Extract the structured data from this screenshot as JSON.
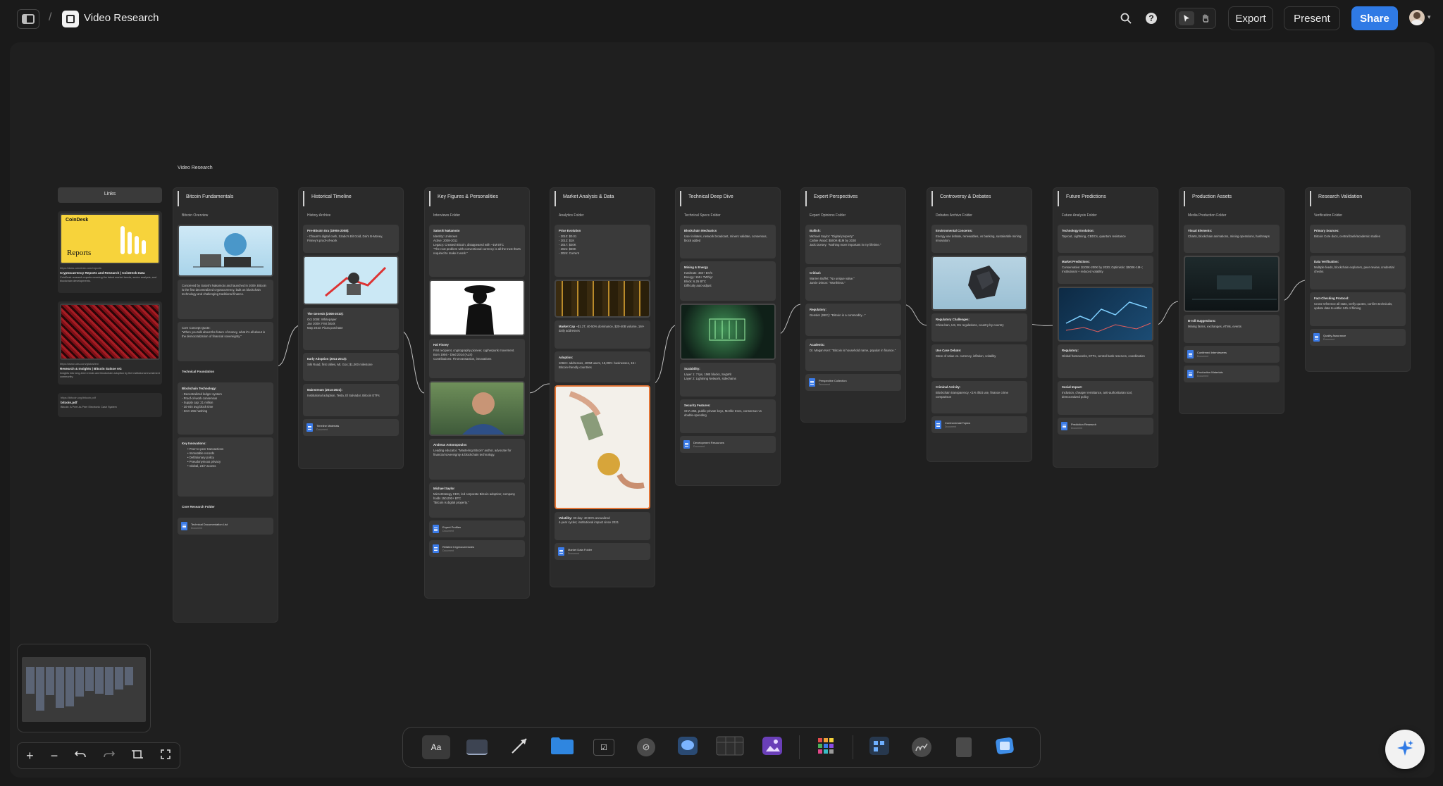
{
  "app": {
    "breadcrumb_sep": "/",
    "title": "Video Research"
  },
  "header": {
    "export": "Export",
    "present": "Present",
    "share": "Share"
  },
  "board": {
    "label": "Video Research"
  },
  "links": {
    "title": "Links",
    "items": [
      {
        "thumb_brand": "CoinDesk",
        "thumb_title": "Reports",
        "url": "https://data.coindesk.com/reports",
        "title": "Cryptocurrency Reports and Research | CoinDesk Data",
        "desc": "CoinDesk research reports covering the latest market trends, sector analysis, and blockchain developments."
      },
      {
        "url": "https://www.ubs.com/global/en/",
        "title": "Research & Insights | Bitcoin Suisse AG",
        "desc": "Insights into long-term trends and blockchain adoption by the institutional investment community."
      },
      {
        "url": "https://bitcoin.org/bitcoin.pdf",
        "title": "bitcoin.pdf",
        "desc": "Bitcoin: A Peer-to-Peer Electronic Cash System"
      }
    ]
  },
  "columns": [
    {
      "title": "Bitcoin Fundamentals",
      "sub": "Bitcoin Overview"
    },
    {
      "title": "Historical Timeline",
      "sub": "History Archive"
    },
    {
      "title": "Key Figures & Personalities",
      "sub": "Interviews Folder"
    },
    {
      "title": "Market Analysis & Data",
      "sub": "Analytics Folder"
    },
    {
      "title": "Technical Deep Dive",
      "sub": "Technical Specs Folder"
    },
    {
      "title": "Expert Perspectives",
      "sub": "Expert Opinions Folder"
    },
    {
      "title": "Controversy & Debates",
      "sub": "Debates Archive Folder"
    },
    {
      "title": "Future Predictions",
      "sub": "Future Analysis Folder"
    },
    {
      "title": "Production Assets",
      "sub": "Media Production Folder"
    },
    {
      "title": "Research Validation",
      "sub": "Verification Folder"
    }
  ],
  "fundamentals": {
    "intro": "Conceived by Satoshi Nakamoto and launched in 2009, Bitcoin is the first decentralized cryptocurrency, built on blockchain technology and challenging traditional finance.",
    "quote_title": "Core Concept Quote:",
    "quote": "\"When you talk about the future of money, what it's all about is the democratization of financial sovereignty.\"",
    "tech_foundation": "Technical Foundation",
    "bt_title": "Blockchain Technology:",
    "bt_items": [
      "- Decentralized ledger system",
      "- Proof-of-work consensus",
      "- Supply cap: 21 million",
      "- 10-min avg block time",
      "- SHA-256 hashing"
    ],
    "ki_title": "Key Innovations:",
    "ki_items": [
      "• Peer-to-peer transactions",
      "• Immutable records",
      "• Deflationary policy",
      "• Pseudonymous privacy",
      "• Global, 24/7 access"
    ],
    "core_folder": "Core Research Folder",
    "doc": "Technical Documentation List"
  },
  "history": {
    "c1_title": "Pre-Bitcoin Era (1990s-2008):",
    "c1": "- Chaum's digital cash, Szabo's Bit Gold, Dai's B-Money, Finney's proof-of-work",
    "c2_title": "The Genesis (2008-2010):",
    "c2": "Oct 2008: Whitepaper\nJan 2009: First block\nMay 2010: Pizza purchase",
    "c3_title": "Early Adoption (2011-2013):",
    "c3": "Silk Road, first rallies, Mt. Gox; $1,000 milestone",
    "c4_title": "Mainstream (2014-2021):",
    "c4": "Institutional adoption, Tesla, El Salvador, Bitcoin ETFs",
    "doc": "Timeline Materials"
  },
  "figures": {
    "c1_title": "Satoshi Nakamoto",
    "c1": "Identity: Unknown\nActive: 2008-2011\nLegacy: Created Bitcoin, disappeared with ~1M BTC\n\"The root problem with conventional currency is all the trust that's required to make it work.\"",
    "c2_title": "Hal Finney",
    "c2": "First recipient, cryptography pioneer, cypherpunk movement.\nBorn 1956 - Died 2014 (ALS)\nContributions: First transaction, innovations",
    "c3_title": "Andreas Antonopoulos",
    "c3": "Leading educator, \"Mastering Bitcoin\" author, advocate for financial sovereignty & blockchain technology.",
    "c4_title": "Michael Saylor",
    "c4": "MicroStrategy CEO, led corporate Bitcoin adoption; company holds 150,000+ BTC\n\"Bitcoin is digital property.\"",
    "doc1": "Expert Profiles",
    "doc2": "Related Cryptocurrencies"
  },
  "market": {
    "c1_title": "Price Evolution",
    "c1": "- 2010: $0.01\n- 2013: $1K\n- 2017: $20K\n- 2021: $69K\n- 2024: Current",
    "c2_title": "Market Cap",
    "c2": "~$1.2T, 40-50% dominance, $20-40B volume, 1M+ daily addresses",
    "c3_title": "Adoption:",
    "c3": "106M+ addresses, 400M users, 15,000+ businesses, 15+ Bitcoin-friendly countries",
    "c4_title": "Volatility:",
    "c4": "30-day: 40-80% annualized\n4-year cycles; institutional impact since 2021",
    "doc": "Market Data Folder"
  },
  "technical": {
    "c1_title": "Blockchain Mechanics",
    "c1": "User initiates, network broadcast, miners validate, consensus, block added",
    "c2_title": "Mining & Energy",
    "c2": "Hashrate: 450+ EH/s\nEnergy: 150+ TWh/yr\nBlock: 6.25 BTC\nDifficulty auto-adjust",
    "c3_title": "Scalability:",
    "c3": "Layer 1: 7 tps, 1MB blocks, SegWit\nLayer 2: Lightning Network, sidechains",
    "c4_title": "Security Features:",
    "c4": "SHA-256, public-private keys, Merkle trees, consensus vs double-spending",
    "doc": "Development Resources"
  },
  "experts": {
    "c1_title": "Bullish:",
    "c1": "Michael Saylor: \"Digital property\"\nCathie Wood: $500K-$1M by 2030\nJack Dorsey: \"Nothing more important in my lifetime.\"",
    "c2_title": "Critical:",
    "c2": "Warren Buffet: \"No unique value.\"\nJamie Dimon: \"Worthless.\"",
    "c3_title": "Regulatory:",
    "c3": "Gensler (SEC): \"Bitcoin is a commodity...\"",
    "c4_title": "Academic:",
    "c4": "Dr. Megan Kerr: \"Bitcoin is household name, popular in finance.\"",
    "doc": "Perspective Collection"
  },
  "controversy": {
    "c1_title": "Environmental Concerns:",
    "c1": "Energy use debate, renewables, vs banking, sustainable mining innovation",
    "c2_title": "Regulatory Challenges:",
    "c2": "China ban, US, EU regulations, country-by-country",
    "c3_title": "Use Case Debate:",
    "c3": "Store of value vs. currency, inflation, volatility",
    "c4_title": "Criminal Activity:",
    "c4": "Blockchain transparency, <1% illicit use, finance crime comparison",
    "doc": "Controversial Topics"
  },
  "future": {
    "c1_title": "Technology Evolution:",
    "c1": "Taproot, Lightning, CBDCs, quantum resistance",
    "c2_title": "Market Predictions:",
    "c2": "Conservative: $100K-200K by 2030; Optimistic: $500K-1M+; Institutional + reduced volatility",
    "c3_title": "Regulatory:",
    "c3": "Global frameworks, ETFs, central bank reserves, coordination",
    "c4_title": "Social Impact:",
    "c4": "Inclusion, cheaper remittance, anti-authoritarian tool, democratized policy",
    "doc": "Prediction Research"
  },
  "production": {
    "c1_title": "Visual Elements:",
    "c1": "Charts, blockchain animations, mining operations, hashmaps",
    "c2_title": "B-roll Suggestions:",
    "c2": "Mining farms, exchanges, ATMs, events",
    "doc1": "Confirmed Interviewees",
    "doc2": "Production Materials"
  },
  "validation": {
    "c1_title": "Primary Sources:",
    "c1": "Bitcoin Core docs, central bank/academic studies",
    "c2_title": "Data Verification:",
    "c2": "Multiple feeds, blockchain explorers, peer-review, credential checks",
    "c3_title": "Fact-Checking Protocol:",
    "c3": "Cross-reference all stats, verify quotes, confirm technicals, update data to within 24h of filming",
    "doc": "Quality Assurance"
  },
  "doc_meta": "Document",
  "zoom": {
    "in": "+",
    "out": "−"
  },
  "toolbar": {
    "text_tool": "Aa"
  }
}
